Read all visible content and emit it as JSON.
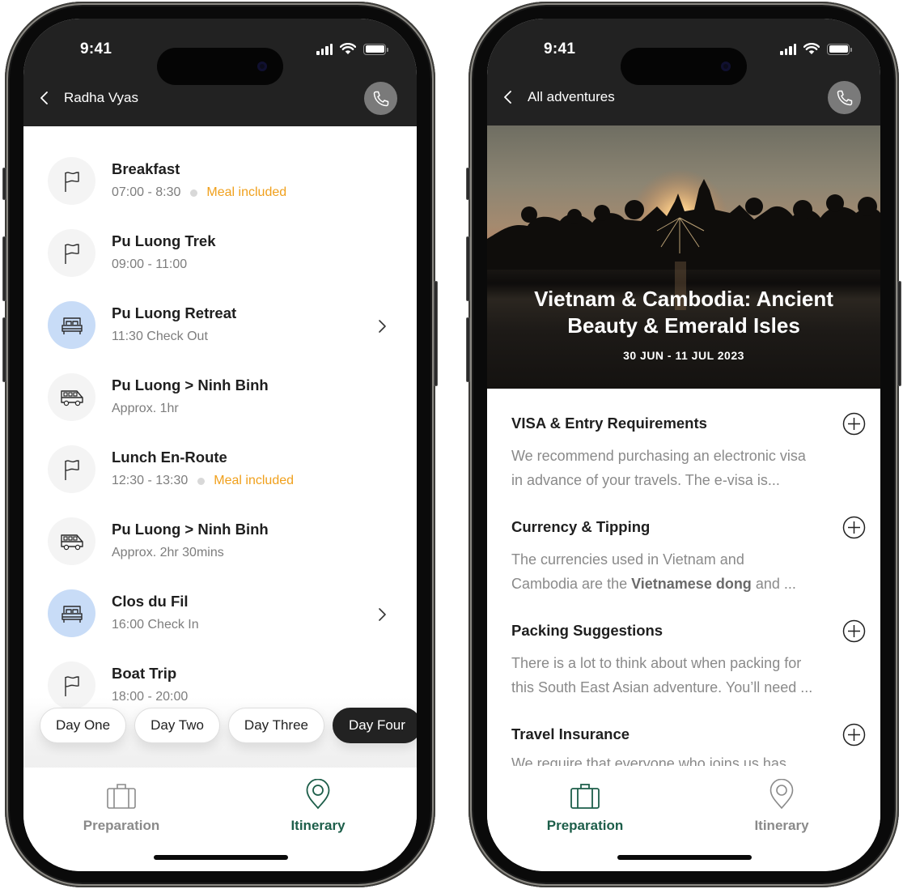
{
  "status_bar": {
    "time": "9:41"
  },
  "left_phone": {
    "nav": {
      "title": "Radha Vyas"
    },
    "itinerary": [
      {
        "icon": "flag",
        "title": "Breakfast",
        "subtitle": "07:00 - 8:30",
        "tag": "Meal included",
        "has_chevron": false
      },
      {
        "icon": "flag",
        "title": "Pu Luong Trek",
        "subtitle": "09:00 - 11:00",
        "tag": "",
        "has_chevron": false
      },
      {
        "icon": "bed",
        "title": "Pu Luong Retreat",
        "subtitle": "11:30 Check Out",
        "tag": "",
        "has_chevron": true
      },
      {
        "icon": "van",
        "title": "Pu Luong > Ninh Binh",
        "subtitle": "Approx. 1hr",
        "tag": "",
        "has_chevron": false
      },
      {
        "icon": "flag",
        "title": "Lunch En-Route",
        "subtitle": "12:30 - 13:30",
        "tag": "Meal included",
        "has_chevron": false
      },
      {
        "icon": "van",
        "title": "Pu Luong > Ninh Binh",
        "subtitle": "Approx. 2hr 30mins",
        "tag": "",
        "has_chevron": false
      },
      {
        "icon": "bed",
        "title": "Clos du Fil",
        "subtitle": "16:00 Check In",
        "tag": "",
        "has_chevron": true
      },
      {
        "icon": "flag",
        "title": "Boat Trip",
        "subtitle": "18:00 - 20:00",
        "tag": "",
        "has_chevron": false
      }
    ],
    "day_chips": [
      {
        "label": "Day One",
        "active": false
      },
      {
        "label": "Day Two",
        "active": false
      },
      {
        "label": "Day Three",
        "active": false
      },
      {
        "label": "Day Four",
        "active": true
      }
    ],
    "tabs": [
      {
        "label": "Preparation",
        "icon": "suitcase",
        "active": false
      },
      {
        "label": "Itinerary",
        "icon": "map-pin",
        "active": true
      }
    ]
  },
  "right_phone": {
    "nav": {
      "title": "All adventures"
    },
    "hero": {
      "title_line1": "Vietnam & Cambodia: Ancient",
      "title_line2": "Beauty & Emerald Isles",
      "dates": "30 JUN - 11 JUL 2023"
    },
    "sections": [
      {
        "title": "VISA & Entry Requirements",
        "line1": "We recommend purchasing an electronic visa",
        "line2": "in advance of your travels. The e-visa is..."
      },
      {
        "title": "Currency & Tipping",
        "line1": "The currencies used in Vietnam and",
        "line2_pre": "Cambodia are the ",
        "line2_bold": "Vietnamese dong",
        "line2_post": " and ..."
      },
      {
        "title": "Packing Suggestions",
        "line1": "There is a lot to think about when packing for",
        "line2": "this South East Asian adventure. You’ll need ..."
      },
      {
        "title": "Travel Insurance",
        "line1": "We require that everyone who joins us has"
      }
    ],
    "tabs": [
      {
        "label": "Preparation",
        "icon": "suitcase",
        "active": true
      },
      {
        "label": "Itinerary",
        "icon": "map-pin",
        "active": false
      }
    ]
  },
  "colors": {
    "header_bg": "#222222",
    "accent_green": "#1d5e4a",
    "meal_orange": "#f0a01c",
    "lodging_blue": "#c8dcf7",
    "icon_bg_gray": "#f4f4f4"
  }
}
